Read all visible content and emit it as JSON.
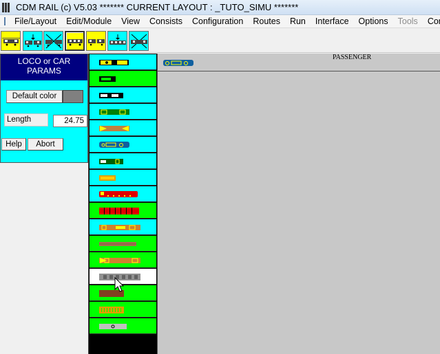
{
  "window": {
    "title": "CDM RAIL (c) V5.03     ******* CURRENT LAYOUT : _TUTO_SIMU *******"
  },
  "menu": {
    "items": [
      {
        "label": "File/Layout",
        "enabled": true
      },
      {
        "label": "Edit/Module",
        "enabled": true
      },
      {
        "label": "View",
        "enabled": true
      },
      {
        "label": "Consists",
        "enabled": true
      },
      {
        "label": "Configuration",
        "enabled": true
      },
      {
        "label": "Routes",
        "enabled": true
      },
      {
        "label": "Run",
        "enabled": true
      },
      {
        "label": "Interface",
        "enabled": true
      },
      {
        "label": "Options",
        "enabled": true
      },
      {
        "label": "Tools",
        "enabled": false
      },
      {
        "label": "Com",
        "enabled": true
      }
    ]
  },
  "toolbar": {
    "buttons": [
      {
        "icon": "loco-icon",
        "color": "#ffff00"
      },
      {
        "icon": "couple-icon",
        "color": "#00ffff"
      },
      {
        "icon": "uncouple-icon",
        "color": "#00ffff"
      },
      {
        "icon": "car-icon",
        "color": "#ffff00",
        "selected": true
      },
      {
        "icon": "loco-pair-icon",
        "color": "#ffff00"
      },
      {
        "icon": "couple-train-icon",
        "color": "#00ffff"
      },
      {
        "icon": "uncouple-train-icon",
        "color": "#00ffff"
      }
    ]
  },
  "params": {
    "title": "LOCO or CAR PARAMS",
    "default_color_label": "Default color",
    "default_color": "#808080",
    "length_label": "Length",
    "length_value": "24.75",
    "help_label": "Help",
    "abort_label": "Abort"
  },
  "vehicle_list": {
    "rows": [
      {
        "icon": "diesel-loco-icon",
        "bg": "#00ffff",
        "body": "#ffff00"
      },
      {
        "icon": "box-car-icon",
        "bg": "#00ff00",
        "body": "#000000"
      },
      {
        "icon": "loco-black-icon",
        "bg": "#00ffff",
        "body": "#000000"
      },
      {
        "icon": "green-coach-icon",
        "bg": "#00ffff",
        "body": "#008000"
      },
      {
        "icon": "orange-loco-icon",
        "bg": "#00ffff",
        "body": "#c08040"
      },
      {
        "icon": "passenger-coach-icon",
        "bg": "#00ffff",
        "body": "#1060a0"
      },
      {
        "icon": "green-loco-icon",
        "bg": "#00ffff",
        "body": "#006000"
      },
      {
        "icon": "small-orange-car-icon",
        "bg": "#00ffff",
        "body": "#e0a000"
      },
      {
        "icon": "red-coach-icon",
        "bg": "#00ffff",
        "body": "#e00000"
      },
      {
        "icon": "red-train-icon",
        "bg": "#00ff00",
        "body": "#e00000"
      },
      {
        "icon": "orange-railcar-icon",
        "bg": "#00ffff",
        "body": "#d08030"
      },
      {
        "icon": "flat-car-icon",
        "bg": "#00ff00",
        "body": "#a07050"
      },
      {
        "icon": "orange-yellow-loco-icon",
        "bg": "#00ff00",
        "body": "#d08030"
      },
      {
        "icon": "grey-coach-icon",
        "bg": "#ffffff",
        "body": "#909090"
      },
      {
        "icon": "brown-wagon-icon",
        "bg": "#00ff00",
        "body": "#804020"
      },
      {
        "icon": "ore-car-icon",
        "bg": "#00ff00",
        "body": "#e0a000"
      },
      {
        "icon": "grey-flat-icon",
        "bg": "#00ff00",
        "body": "#c0c0c0"
      }
    ]
  },
  "canvas": {
    "category_label": "PASSENGER",
    "car_icon": "passenger-car-icon"
  }
}
